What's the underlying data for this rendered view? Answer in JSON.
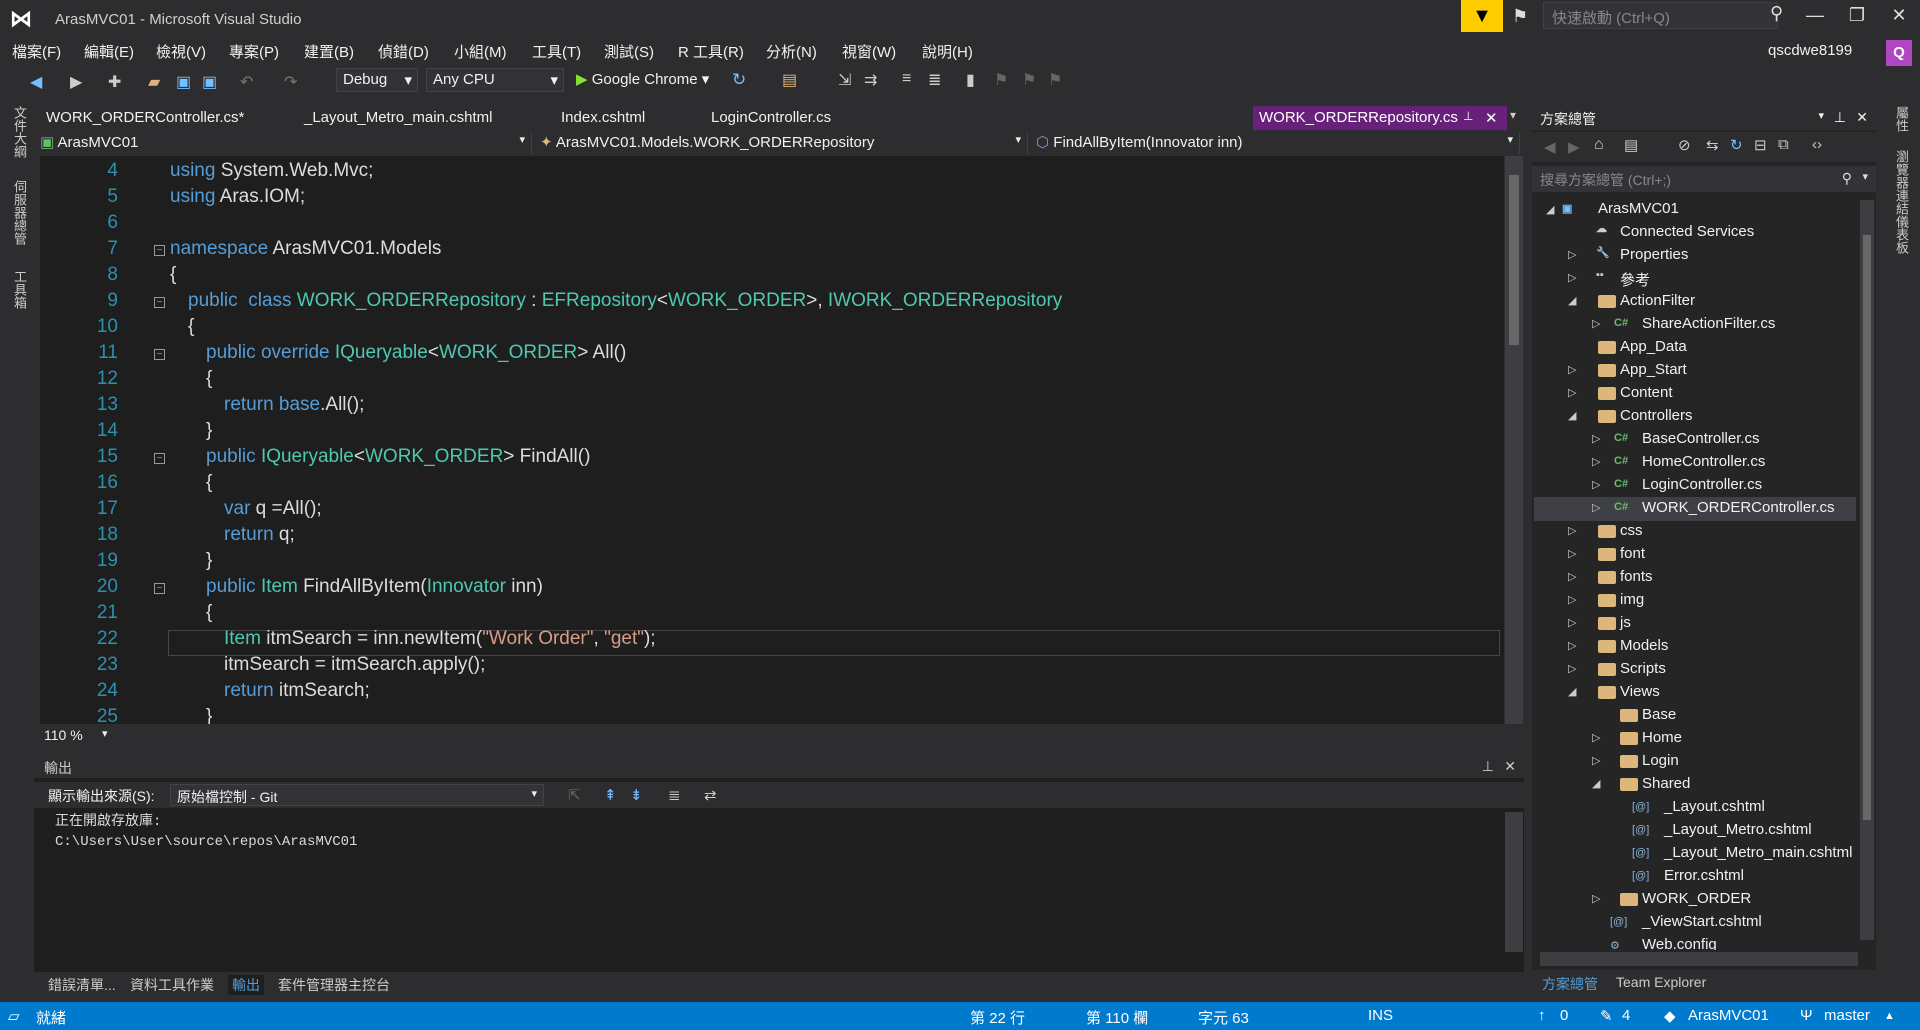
{
  "app": {
    "title": "ArasMVC01 - Microsoft Visual Studio",
    "quick_launch_placeholder": "快速啟動 (Ctrl+Q)",
    "username": "qscdwe8199",
    "avatar_letter": "Q"
  },
  "menu": [
    "檔案(F)",
    "編輯(E)",
    "檢視(V)",
    "專案(P)",
    "建置(B)",
    "偵錯(D)",
    "小組(M)",
    "工具(T)",
    "測試(S)",
    "R 工具(R)",
    "分析(N)",
    "視窗(W)",
    "說明(H)"
  ],
  "toolbar": {
    "config": "Debug",
    "platform": "Any CPU",
    "run_target": "Google Chrome"
  },
  "left_rail": [
    "文件大綱",
    "伺服器總管",
    "工具箱"
  ],
  "right_rail": [
    "屬性",
    "瀏覽器連結儀表板"
  ],
  "tabs": [
    "WORK_ORDERController.cs*",
    "_Layout_Metro_main.cshtml",
    "Index.cshtml",
    "LoginController.cs"
  ],
  "active_tab": "WORK_ORDERRepository.cs",
  "nav": {
    "project": "ArasMVC01",
    "class": "ArasMVC01.Models.WORK_ORDERRepository",
    "member": "FindAllByItem(Innovator inn)"
  },
  "zoom": "110 %",
  "code_lines": [
    "4",
    "5",
    "6",
    "7",
    "8",
    "9",
    "10",
    "11",
    "12",
    "13",
    "14",
    "15",
    "16",
    "17",
    "18",
    "19",
    "20",
    "21",
    "22",
    "23",
    "24",
    "25"
  ],
  "output": {
    "title": "輸出",
    "source_label": "顯示輸出來源(S):",
    "source": "原始檔控制 - Git",
    "text": "正在開啟存放庫:\nC:\\Users\\User\\source\\repos\\ArasMVC01"
  },
  "bottom_tabs": [
    "錯誤清單...",
    "資料工具作業",
    "輸出",
    "套件管理器主控台"
  ],
  "solution": {
    "title": "方案總管",
    "search_placeholder": "搜尋方案總管 (Ctrl+;)",
    "items": [
      "ArasMVC01",
      "Connected Services",
      "Properties",
      "參考",
      "ActionFilter",
      "ShareActionFilter.cs",
      "App_Data",
      "App_Start",
      "Content",
      "Controllers",
      "BaseController.cs",
      "HomeController.cs",
      "LoginController.cs",
      "WORK_ORDERController.cs",
      "css",
      "font",
      "fonts",
      "img",
      "js",
      "Models",
      "Scripts",
      "Views",
      "Base",
      "Home",
      "Login",
      "Shared",
      "_Layout.cshtml",
      "_Layout_Metro.cshtml",
      "_Layout_Metro_main.cshtml",
      "Error.cshtml",
      "WORK_ORDER",
      "_ViewStart.cshtml",
      "Web.config"
    ],
    "bottom_tabs": [
      "方案總管",
      "Team Explorer"
    ]
  },
  "status": {
    "ready": "就緒",
    "line": "第 22 行",
    "col": "第 110 欄",
    "char": "字元 63",
    "ins": "INS",
    "up": "0",
    "edits": "4",
    "repo": "ArasMVC01",
    "branch": "master"
  }
}
